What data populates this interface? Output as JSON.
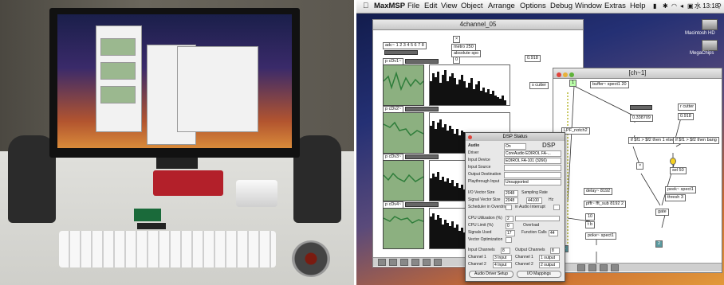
{
  "menubar": {
    "apple": "",
    "app": "MaxMSP",
    "items": [
      "File",
      "Edit",
      "View",
      "Object",
      "Arrange",
      "Options",
      "Debug",
      "Window",
      "Extras",
      "Help"
    ],
    "status_icons": [
      "battery-icon",
      "bluetooth-icon",
      "wifi-icon",
      "volume-icon",
      "input-icon"
    ],
    "clock": "水 13:18",
    "search_icon": "search-icon"
  },
  "desktop": {
    "icons": [
      "Macintosh HD",
      "MegaChips"
    ]
  },
  "main_window": {
    "title": "4channel_05",
    "objects": {
      "message": "adc~ 1 2 3 4 5 6 7 8",
      "metro": "metro 250",
      "number_box": "0.918",
      "cutter": "s cutter",
      "absolute": "absolute spo",
      "zero": "0",
      "dspl1": "p cDv1~",
      "dspl2": "p cDv2~",
      "dspl3": "p cDv3~",
      "dspl4": "p cDv4~"
    }
  },
  "ch_window": {
    "title": "[ch~1]",
    "objects": {
      "buffer": "buffer~ spect1 20",
      "num1": "0.338709",
      "rcutter": "r cutter",
      "num2": "0.918",
      "if1": "if $f1 > $f2 then 1 else 0",
      "if2": "if $f1 > $f2 then bang",
      "lpf": "LPF_notch2",
      "delay": "delay~ 8192",
      "fftsub": "pfft~ fft_sub 8192 2",
      "ten": "10",
      "tb": "t b",
      "thresh": "thresh 3",
      "peek": "peek~ spect1",
      "gate": "gate",
      "poke": "poke~ spect1",
      "sel50": "sel 50",
      "inlet1": "1",
      "inlet2": "2"
    }
  },
  "dsp_status": {
    "title": "DSP Status",
    "logo": "DSP",
    "rows": {
      "audio": {
        "label": "Audio",
        "value": "On"
      },
      "driver": {
        "label": "Driver",
        "value": "CoreAudio EDIROL FA-..."
      },
      "input_device": {
        "label": "Input Device",
        "value": "EDIROL FA-101 (3266)"
      },
      "input_source": {
        "label": "Input Source",
        "value": ""
      },
      "output_destination": {
        "label": "Output Destination",
        "value": ""
      },
      "playthrough": {
        "label": "Playthrough Input",
        "value": "Unsupported"
      },
      "io_vector": {
        "label": "I/O Vector Size",
        "value": "2048"
      },
      "sampling_rate": {
        "label": "Sampling Rate",
        "value": "44100"
      },
      "signal_vector": {
        "label": "Signal Vector Size",
        "value": "2048"
      },
      "sr_unit": "Hz",
      "scheduler": {
        "label": "Scheduler in Overdrive"
      },
      "interrupt": {
        "label": "in Audio Interrupt"
      },
      "cpu_util": {
        "label": "CPU Utilization (%)",
        "value": "2"
      },
      "cpu_limit": {
        "label": "CPU Limit (%)",
        "value": "0"
      },
      "overload": {
        "label": "Overload"
      },
      "signals_used": {
        "label": "Signals Used",
        "value": "17"
      },
      "function_calls": {
        "label": "Function Calls",
        "value": "44"
      },
      "vector_opt": {
        "label": "Vector Optimization"
      },
      "input_channels": {
        "label": "Input Channels",
        "value": "8"
      },
      "output_channels": {
        "label": "Output Channels",
        "value": "8"
      },
      "in_ch1": {
        "label": "Channel 1",
        "value": "3 Input"
      },
      "in_ch2": {
        "label": "Channel 2",
        "value": "4 Input"
      },
      "out_ch1": {
        "label": "Channel 1",
        "value": "1 output"
      },
      "out_ch2": {
        "label": "Channel 2",
        "value": "2 output"
      },
      "audio_driver_setup": "Audio Driver Setup",
      "io_mappings": "I/O Mappings"
    }
  },
  "colors": {
    "graph_bg": "#8cb080",
    "trace": "#2e7d3a",
    "patchcord": "#a6a600",
    "meter_green": "#4caf2c",
    "ch_inlet": "#5a9aa0"
  },
  "photo": {
    "description_free": true
  }
}
